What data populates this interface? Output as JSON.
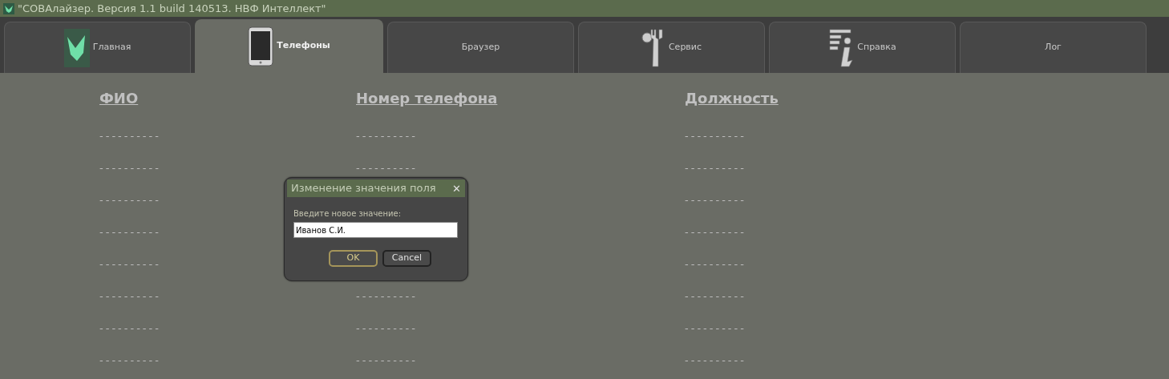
{
  "window": {
    "title": "\"СОВАлайзер. Версия 1.1 build 140513. НВФ Интеллект\""
  },
  "tabs": [
    {
      "label": "Главная",
      "selected": false
    },
    {
      "label": "Телефоны",
      "selected": true
    },
    {
      "label": "Браузер",
      "selected": false
    },
    {
      "label": "Сервис",
      "selected": false
    },
    {
      "label": "Справка",
      "selected": false
    },
    {
      "label": "Лог",
      "selected": false
    }
  ],
  "table": {
    "columns": [
      "ФИО",
      "Номер телефона",
      "Должность"
    ],
    "rows": [
      {
        "name": "----------",
        "phone": "----------",
        "position": "----------"
      },
      {
        "name": "----------",
        "phone": "----------",
        "position": "----------"
      },
      {
        "name": "----------",
        "position": "----------"
      },
      {
        "name": "----------",
        "position": "----------"
      },
      {
        "name": "----------",
        "position": "----------"
      },
      {
        "name": "----------",
        "phone": "----------",
        "position": "----------"
      },
      {
        "name": "----------",
        "phone": "----------",
        "position": "----------"
      },
      {
        "name": "----------",
        "phone": "----------",
        "position": "----------"
      }
    ]
  },
  "dialog": {
    "title": "Изменение значения поля",
    "close": "✕",
    "prompt": "Введите новое значение:",
    "value": "Иванов С.И.",
    "buttons": [
      {
        "label": "OK",
        "default": true
      },
      {
        "label": "Cancel",
        "default": false
      }
    ]
  }
}
